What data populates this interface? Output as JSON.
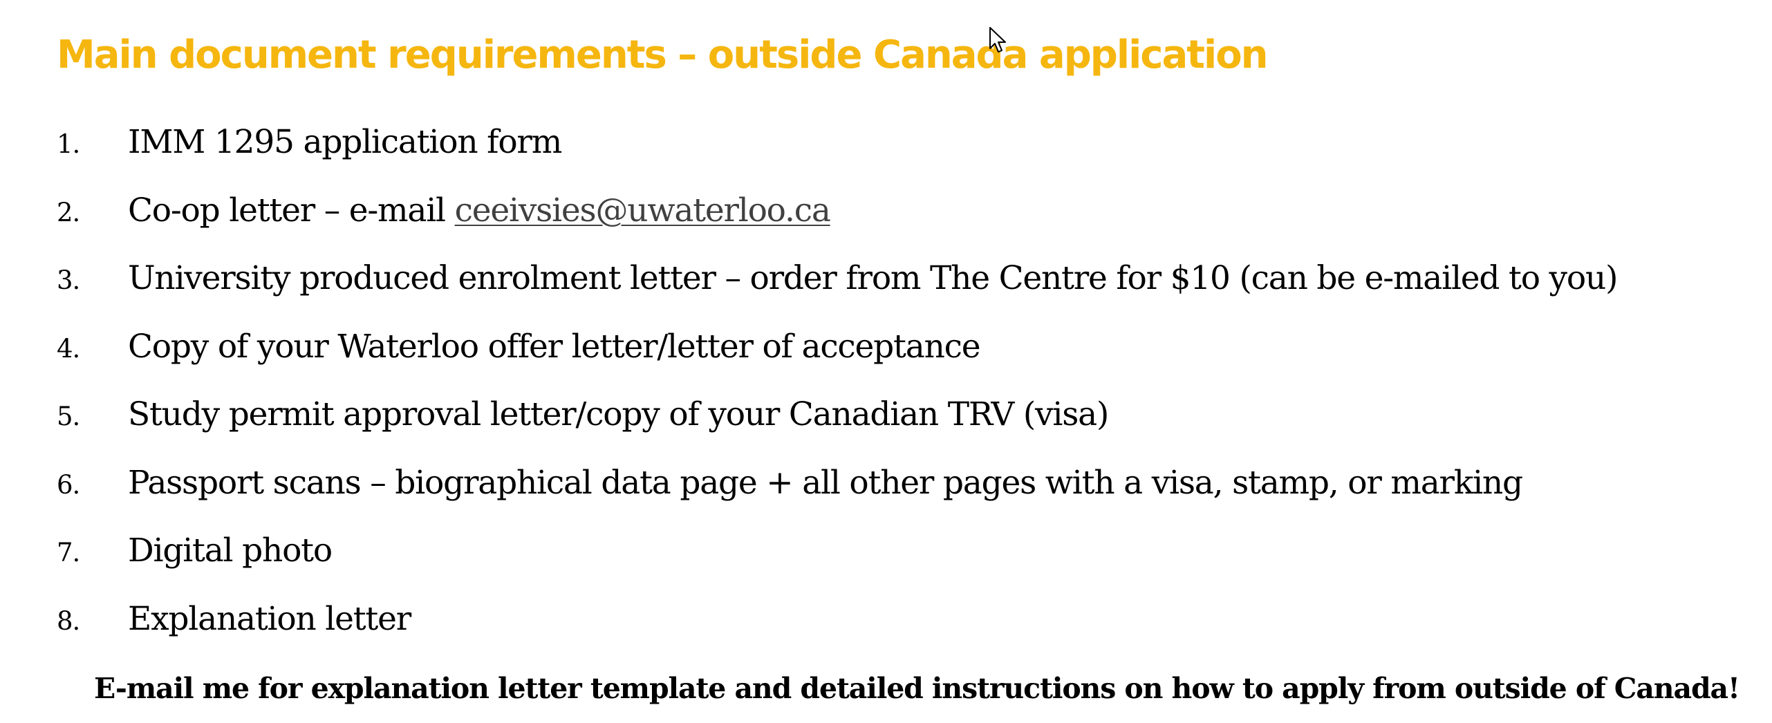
{
  "slide": {
    "title": "Main document requirements – outside Canada application",
    "items": [
      {
        "number": "1.",
        "text": "IMM 1295 application form"
      },
      {
        "number": "2.",
        "text": "Co-op letter – e-mail ",
        "link": "ceeivsies@uwaterloo.ca"
      },
      {
        "number": "3.",
        "text": "University produced enrolment letter – order from The Centre for $10 (can be e-mailed to you)"
      },
      {
        "number": "4.",
        "text": "Copy of your Waterloo offer letter/letter of acceptance"
      },
      {
        "number": "5.",
        "text": "Study permit approval letter/copy of your Canadian TRV (visa)"
      },
      {
        "number": "6.",
        "text": "Passport scans – biographical data page + all other pages with a visa, stamp, or marking"
      },
      {
        "number": "7.",
        "text": "Digital photo"
      },
      {
        "number": "8.",
        "text": "Explanation letter"
      }
    ],
    "footer": "E-mail me for explanation letter template and detailed instructions on how to apply from outside of Canada!"
  },
  "colors": {
    "title": "#f5b60f",
    "body_text": "#000000",
    "link": "#404040",
    "background": "#ffffff"
  },
  "cursor": {
    "icon": "mouse-pointer-icon"
  }
}
